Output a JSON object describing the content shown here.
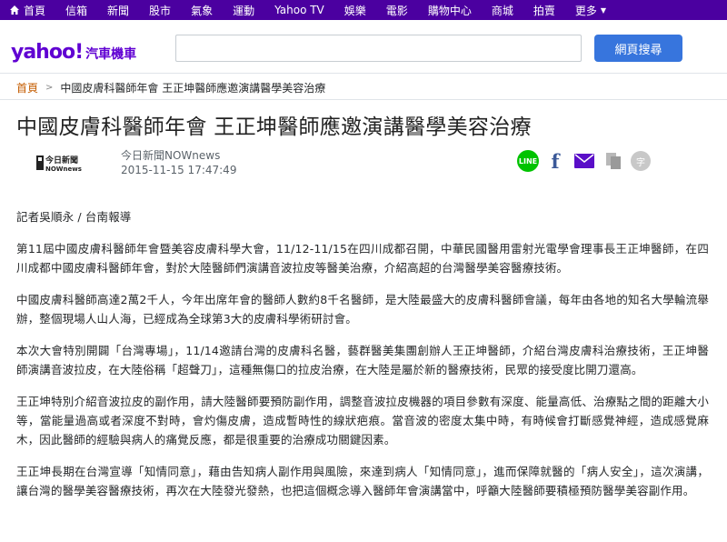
{
  "topnav": {
    "items": [
      "首頁",
      "信箱",
      "新聞",
      "股市",
      "氣象",
      "運動",
      "Yahoo TV",
      "娛樂",
      "電影",
      "購物中心",
      "商城",
      "拍賣",
      "更多"
    ]
  },
  "header": {
    "logo_brand": "yahoo!",
    "logo_section": "汽車機車",
    "search_value": "",
    "search_button": "網頁搜尋"
  },
  "breadcrumb": {
    "home": "首頁",
    "current": "中國皮膚科醫師年會 王正坤醫師應邀演講醫學美容治療"
  },
  "article": {
    "title": "中國皮膚科醫師年會 王正坤醫師應邀演講醫學美容治療",
    "provider_logo_text": "今日新聞",
    "provider_logo_sub": "NOWnews",
    "provider": "今日新聞NOWnews",
    "published": "2015-11-15 17:47:49",
    "paragraphs": [
      "記者吳順永 / 台南報導",
      "第11屆中國皮膚科醫師年會暨美容皮膚科學大會，11/12-11/15在四川成都召開，中華民國醫用雷射光電學會理事長王正坤醫師，在四川成都中國皮膚科醫師年會，對於大陸醫師們演講音波拉皮等醫美治療，介紹高超的台灣醫學美容醫療技術。",
      "中國皮膚科醫師高達2萬2千人，今年出席年會的醫師人數約8千名醫師，是大陸最盛大的皮膚科醫師會議，每年由各地的知名大學輪流舉辦，整個現場人山人海，已經成為全球第3大的皮膚科學術研討會。",
      "本次大會特別開闢「台灣專場」，11/14邀請台灣的皮膚科名醫，藝群醫美集團創辦人王正坤醫師，介紹台灣皮膚科治療技術，王正坤醫師演講音波拉皮，在大陸俗稱「超聲刀」，這種無傷口的拉皮治療，在大陸是屬於新的醫療技術，民眾的接受度比開刀還高。",
      "王正坤特別介紹音波拉皮的副作用，請大陸醫師要預防副作用，調整音波拉皮機器的項目參數有深度、能量高低、治療點之間的距離大小等，當能量過高或者深度不對時，會灼傷皮膚，造成暫時性的線狀疤痕。當音波的密度太集中時，有時候會打斷感覺神經，造成感覺麻木，因此醫師的經驗與病人的痛覺反應，都是很重要的治療成功關鍵因素。",
      "王正坤長期在台灣宣導「知情同意」，藉由告知病人副作用與風險，來達到病人「知情同意」，進而保障就醫的「病人安全」，這次演講，讓台灣的醫學美容醫療技術，再次在大陸發光發熱，也把這個概念導入醫師年會演講當中，呼籲大陸醫師要積極預防醫學美容副作用。"
    ]
  },
  "share": {
    "line_label": "LINE",
    "facebook_label": "f",
    "font_label": "字"
  },
  "colors": {
    "nav_bg": "#4b00a0",
    "brand": "#6001d2",
    "search_button": "#3775dd",
    "line": "#00c300",
    "facebook": "#3b5998",
    "breadcrumb_home": "#c45c00"
  },
  "icons": {
    "home": "home-icon",
    "more": "chevron-down-icon",
    "line": "line-icon",
    "facebook": "facebook-icon",
    "mail": "mail-icon",
    "copy": "copy-icon",
    "font_size": "font-size-icon"
  }
}
